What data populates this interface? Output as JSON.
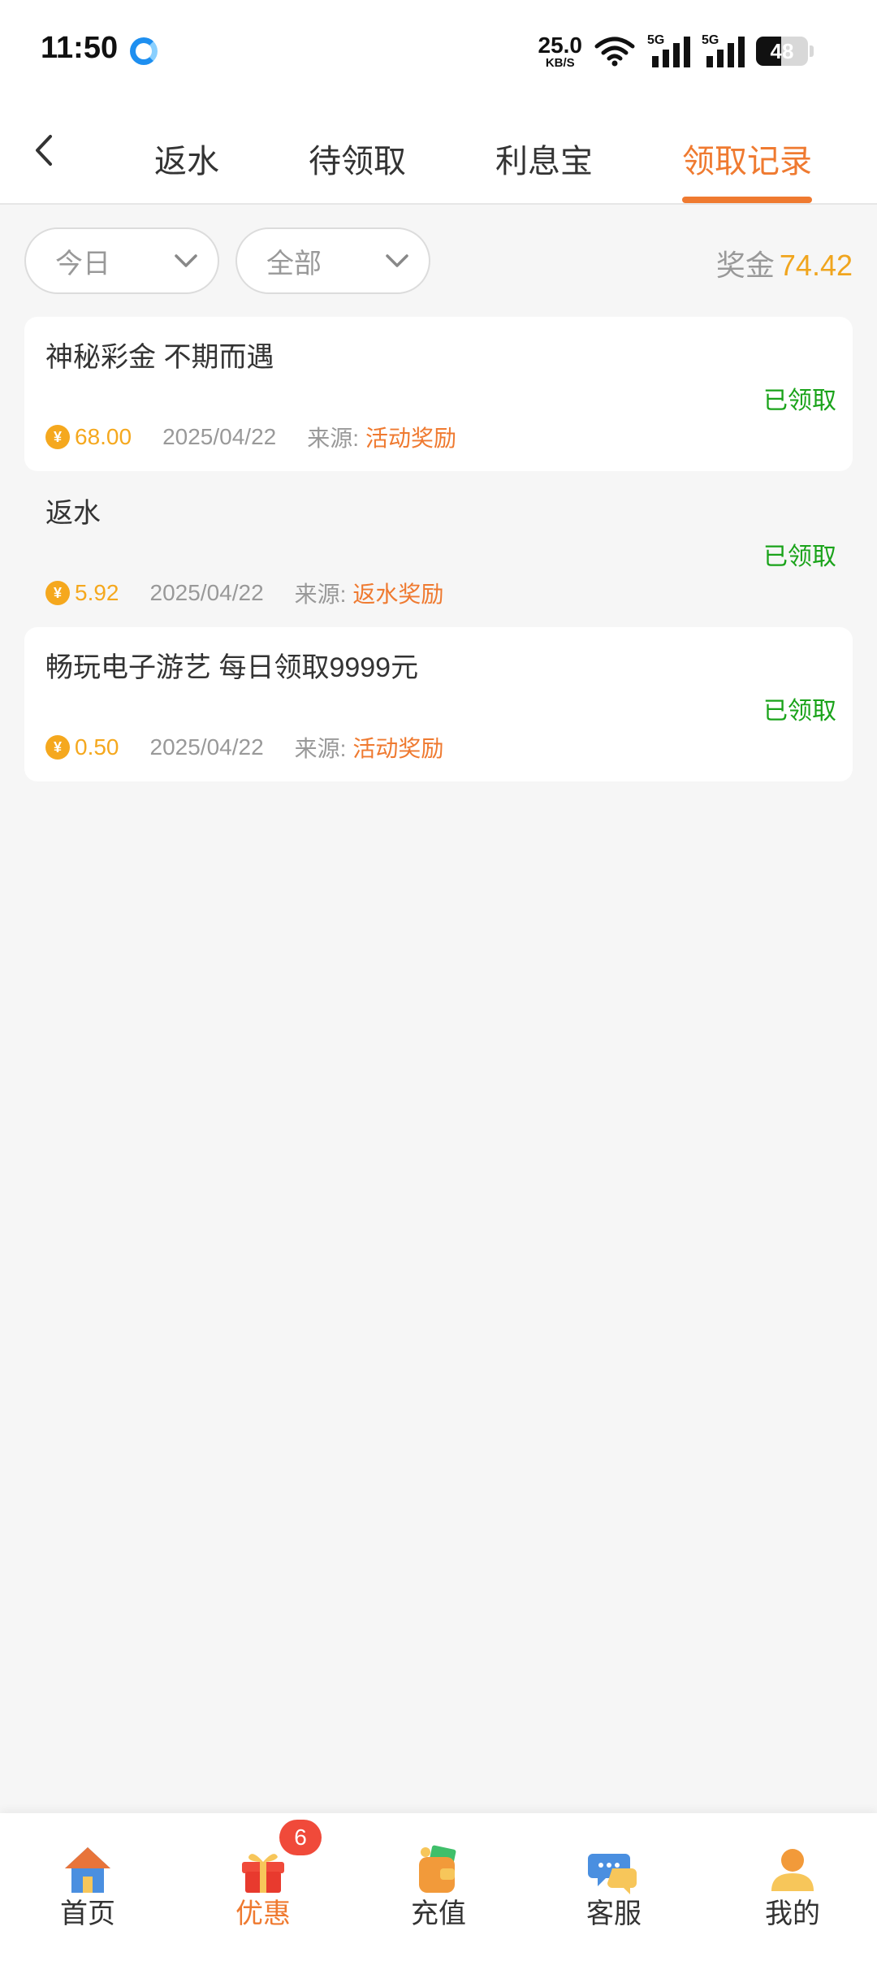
{
  "status_bar": {
    "time": "11:50",
    "net_speed": "25.0",
    "net_unit": "KB/S",
    "signal_tag": "5G",
    "battery": "48"
  },
  "tabs": [
    {
      "label": "返水",
      "active": false
    },
    {
      "label": "待领取",
      "active": false
    },
    {
      "label": "利息宝",
      "active": false
    },
    {
      "label": "领取记录",
      "active": true
    }
  ],
  "filters": {
    "date": "今日",
    "type": "全部"
  },
  "bonus": {
    "label": "奖金",
    "amount": "74.42"
  },
  "records": [
    {
      "title": "神秘彩金 不期而遇",
      "status": "已领取",
      "amount": "68.00",
      "date": "2025/04/22",
      "source_label": "来源:",
      "source": "活动奖励"
    },
    {
      "title": "返水",
      "status": "已领取",
      "amount": "5.92",
      "date": "2025/04/22",
      "source_label": "来源:",
      "source": "返水奖励"
    },
    {
      "title": "畅玩电子游艺 每日领取9999元",
      "status": "已领取",
      "amount": "0.50",
      "date": "2025/04/22",
      "source_label": "来源:",
      "source": "活动奖励"
    }
  ],
  "coin_symbol": "¥",
  "bottom_nav": {
    "items": [
      {
        "label": "首页",
        "icon": "house-icon",
        "active": false
      },
      {
        "label": "优惠",
        "icon": "gift-icon",
        "active": true
      },
      {
        "label": "充值",
        "icon": "wallet-icon",
        "active": false
      },
      {
        "label": "客服",
        "icon": "chat-bubble-icon",
        "active": false
      },
      {
        "label": "我的",
        "icon": "user-icon",
        "active": false
      }
    ],
    "badge": "6"
  },
  "colors": {
    "accent": "#ef7a30",
    "gold": "#f5a81e",
    "success": "#1aa31a"
  }
}
